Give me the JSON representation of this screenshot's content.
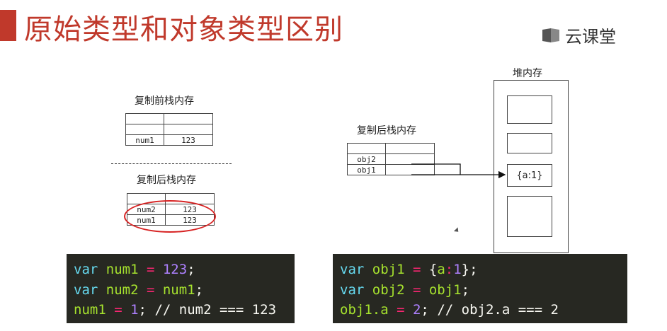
{
  "header": {
    "title": "原始类型和对象类型区别",
    "logo_text": "云课堂"
  },
  "left": {
    "before_label": "复制前栈内存",
    "after_label": "复制后栈内存",
    "before_rows": [
      [
        "",
        ""
      ],
      [
        "",
        ""
      ],
      [
        "num1",
        "123"
      ]
    ],
    "after_rows": [
      [
        "",
        ""
      ],
      [
        "num2",
        "123"
      ],
      [
        "num1",
        "123"
      ]
    ]
  },
  "right": {
    "stack_label": "复制后栈内存",
    "heap_label": "堆内存",
    "stack_rows": [
      [
        "",
        ""
      ],
      [
        "obj2",
        ""
      ],
      [
        "obj1",
        ""
      ]
    ],
    "heap_value": "{a:1}"
  },
  "code_left": {
    "lines": [
      [
        [
          "k",
          "var"
        ],
        [
          "v",
          " num1"
        ],
        [
          "o",
          " ="
        ],
        [
          "n",
          " 123"
        ],
        [
          "p",
          ";"
        ]
      ],
      [
        [
          "k",
          "var"
        ],
        [
          "v",
          " num2"
        ],
        [
          "o",
          " ="
        ],
        [
          "v",
          " num1"
        ],
        [
          "p",
          ";"
        ]
      ],
      [
        [
          "v",
          "num1"
        ],
        [
          "o",
          " ="
        ],
        [
          "n",
          " 1"
        ],
        [
          "p",
          ";"
        ],
        [
          "c",
          " // num2 === 123"
        ]
      ]
    ]
  },
  "code_right": {
    "lines": [
      [
        [
          "k",
          "var"
        ],
        [
          "v",
          " obj1"
        ],
        [
          "o",
          " ="
        ],
        [
          "p",
          " {"
        ],
        [
          "v",
          "a"
        ],
        [
          "o",
          ":"
        ],
        [
          "n",
          "1"
        ],
        [
          "p",
          "};"
        ]
      ],
      [
        [
          "k",
          "var"
        ],
        [
          "v",
          " obj2"
        ],
        [
          "o",
          " ="
        ],
        [
          "v",
          " obj1"
        ],
        [
          "p",
          ";"
        ]
      ],
      [
        [
          "v",
          "obj1.a"
        ],
        [
          "o",
          " ="
        ],
        [
          "n",
          " 2"
        ],
        [
          "p",
          ";"
        ],
        [
          "c",
          " // obj2.a === 2"
        ]
      ]
    ]
  },
  "colors": {
    "accent": "#c0392b",
    "ellipse": "#d72323",
    "code_bg": "#272822"
  }
}
